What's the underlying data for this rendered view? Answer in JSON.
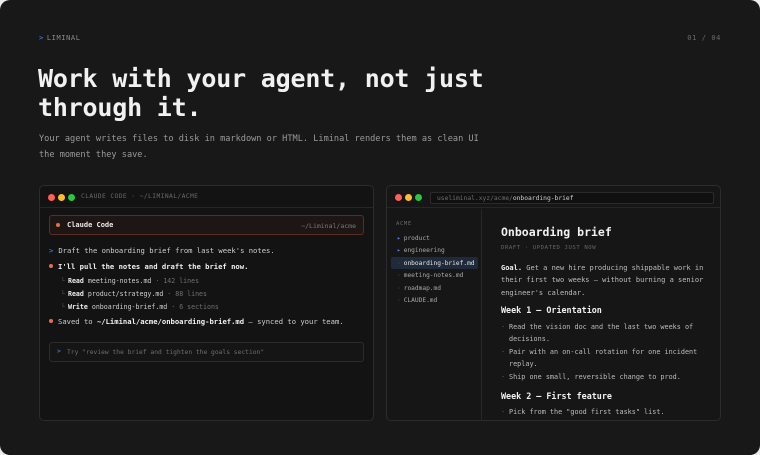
{
  "brand": {
    "caret": ">",
    "name": "LIMINAL",
    "page": "01 / 04"
  },
  "headline": "Work with your agent, not just through it.",
  "subtitle": "Your agent writes files to disk in markdown or HTML. Liminal renders them as clean UI the moment they save.",
  "left_panel": {
    "title": "CLAUDE CODE · ~/LIMINAL/ACME",
    "session": {
      "name": "Claude Code",
      "path": "~/Liminal/acme"
    },
    "user_prompt_marker": ">",
    "user_prompt": "Draft the onboarding brief from last week's notes.",
    "reply": "I'll pull the notes and draft the brief now.",
    "tools": [
      {
        "branch": "└",
        "action": "Read",
        "target": "meeting-notes.md",
        "meta": "· 142 lines"
      },
      {
        "branch": "└",
        "action": "Read",
        "target": "product/strategy.md",
        "meta": "· 88 lines"
      },
      {
        "branch": "└",
        "action": "Write",
        "target": "onboarding-brief.md",
        "meta": "· 6 sections"
      }
    ],
    "saved_prefix": "Saved to ",
    "saved_path": "~/Liminal/acme/onboarding-brief.md",
    "saved_suffix": " — synced to your team.",
    "input": {
      "marker": ">",
      "placeholder": "Try \"review the brief and tighten the goals section\""
    }
  },
  "right_panel": {
    "url_base": "useliminal.xyz/acme/",
    "url_page": "onboarding-brief",
    "sidebar": {
      "label": "ACME",
      "items": [
        {
          "icon": "▸",
          "label": "product",
          "type": "folder",
          "active": false
        },
        {
          "icon": "▸",
          "label": "engineering",
          "type": "folder",
          "active": false
        },
        {
          "icon": "·",
          "label": "onboarding-brief.md",
          "type": "file",
          "active": true
        },
        {
          "icon": "·",
          "label": "meeting-notes.md",
          "type": "file",
          "active": false
        },
        {
          "icon": "·",
          "label": "roadmap.md",
          "type": "file",
          "active": false
        },
        {
          "icon": "·",
          "label": "CLAUDE.md",
          "type": "file",
          "active": false
        }
      ]
    },
    "doc": {
      "title": "Onboarding brief",
      "meta": "DRAFT · UPDATED JUST NOW",
      "goal_label": "Goal.",
      "goal_text": " Get a new hire producing shippable work in their first two weeks — without burning a senior engineer's calendar.",
      "sections": [
        {
          "heading": "Week 1 — Orientation",
          "items": [
            "Read the vision doc and the last two weeks of decisions.",
            "Pair with an on-call rotation for one incident replay.",
            "Ship one small, reversible change to prod."
          ]
        },
        {
          "heading": "Week 2 — First feature",
          "items": [
            "Pick from the \"good first tasks\" list."
          ]
        }
      ]
    }
  },
  "colors": {
    "accent": "#4e8bff",
    "claude": "#e2704e",
    "background": "#181818"
  }
}
